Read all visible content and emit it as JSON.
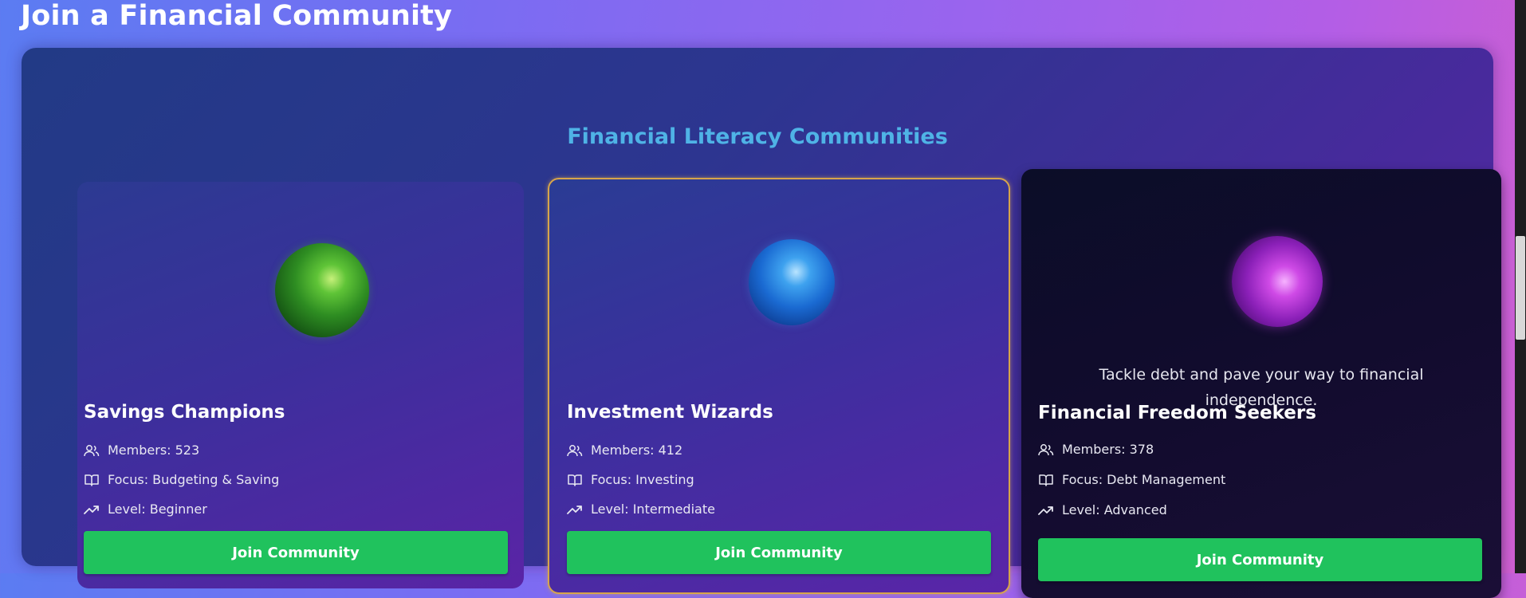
{
  "page": {
    "title": "Join a Financial Community"
  },
  "panel": {
    "heading": "Financial Literacy Communities"
  },
  "communities": [
    {
      "name": "Savings Champions",
      "orb": "green-orb",
      "members": "Members: 523",
      "focus": "Focus: Budgeting & Saving",
      "level": "Level: Beginner",
      "button_label": "Join Community"
    },
    {
      "name": "Investment Wizards",
      "orb": "blue-orb",
      "members": "Members: 412",
      "focus": "Focus: Investing",
      "level": "Level: Intermediate",
      "button_label": "Join Community",
      "selected": true
    },
    {
      "name": "Financial Freedom Seekers",
      "orb": "purple-orb",
      "description": "Tackle debt and pave your way to financial independence.",
      "members": "Members: 378",
      "focus": "Focus: Debt Management",
      "level": "Level: Advanced",
      "button_label": "Join Community"
    }
  ],
  "icons": {
    "members": "users-icon",
    "focus": "book-icon",
    "level": "trending-up-icon"
  },
  "colors": {
    "accent_button": "#20c25d",
    "heading": "#4fb3e6",
    "selected_border": "#d7a54a"
  }
}
